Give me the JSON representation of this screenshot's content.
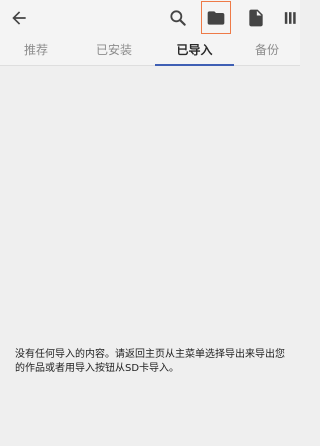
{
  "toolbar": {
    "back_icon": "arrow-left-icon",
    "search_icon": "search-icon",
    "folder_icon": "folder-icon",
    "file_icon": "file-icon",
    "more_icon": "overflow-icon",
    "highlight_color": "#ee7a47"
  },
  "tabs": [
    {
      "label": "推荐",
      "active": false
    },
    {
      "label": "已安装",
      "active": false
    },
    {
      "label": "已导入",
      "active": true
    },
    {
      "label": "备份",
      "active": false
    }
  ],
  "accent_color": "#3f5fb4",
  "main": {
    "empty_message": "没有任何导入的内容。请返回主页从主菜单选择导出来导出您的作品或者用导入按钮从SD卡导入。"
  }
}
